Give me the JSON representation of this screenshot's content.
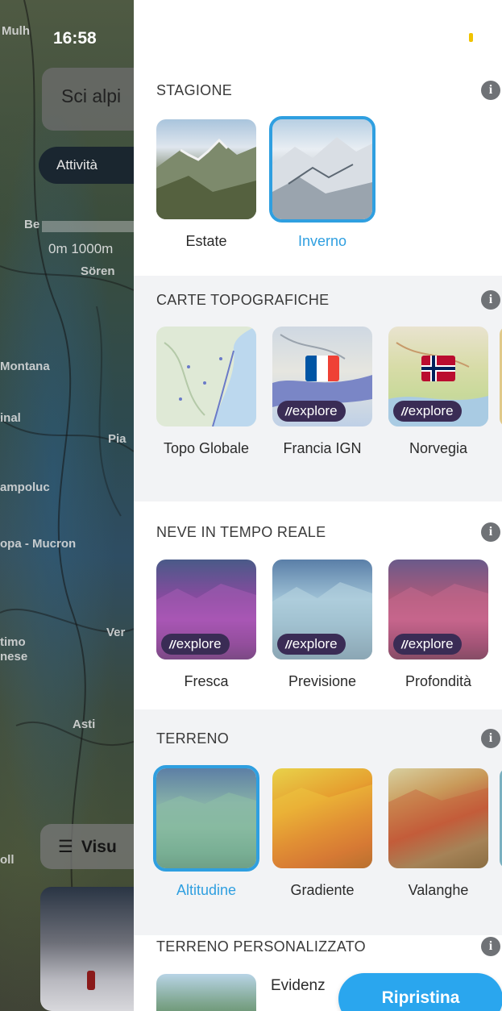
{
  "status_bar": {
    "time": "16:58",
    "indicator_color": "#f0c300"
  },
  "map": {
    "search_text": "Sci alpi",
    "activity_label": "Attività",
    "scale_text": "0m   1000m",
    "place_labels": [
      "Mulh",
      "Be",
      "Sören",
      "Montana",
      "inal",
      "Pia",
      "ampoluc",
      "opa - Mucron",
      "Ver",
      "timo",
      "nese",
      "Asti",
      "oll"
    ],
    "view_button": {
      "icon": "list-icon",
      "label": "Visu"
    }
  },
  "panel": {
    "accent_color": "#2f9fe0",
    "sections": {
      "season": {
        "title": "STAGIONE",
        "items": [
          {
            "label": "Estate",
            "selected": false
          },
          {
            "label": "Inverno",
            "selected": true
          }
        ]
      },
      "topo": {
        "title": "CARTE TOPOGRAFICHE",
        "items": [
          {
            "label": "Topo Globale",
            "badge": ""
          },
          {
            "label": "Francia IGN",
            "badge": "explore",
            "flag": "france-flag-icon"
          },
          {
            "label": "Norvegia",
            "badge": "explore",
            "flag": "norway-flag-icon"
          }
        ]
      },
      "snow": {
        "title": "NEVE IN TEMPO REALE",
        "items": [
          {
            "label": "Fresca",
            "badge": "explore"
          },
          {
            "label": "Previsione",
            "badge": "explore"
          },
          {
            "label": "Profondità",
            "badge": "explore"
          }
        ]
      },
      "terrain": {
        "title": "TERRENO",
        "items": [
          {
            "label": "Altitudine",
            "selected": true
          },
          {
            "label": "Gradiente",
            "selected": false
          },
          {
            "label": "Valanghe",
            "selected": false
          }
        ]
      },
      "custom_terrain": {
        "title": "TERRENO PERSONALIZZATO",
        "item_label": "Evidenz"
      }
    },
    "reset_button": "Ripristina"
  }
}
